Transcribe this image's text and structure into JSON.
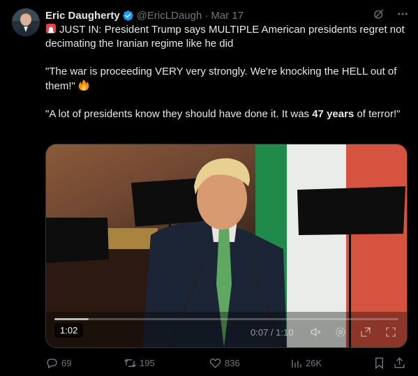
{
  "author": {
    "display_name": "Eric Daugherty",
    "handle": "@EricLDaugh",
    "separator": "·",
    "date": "Mar 17"
  },
  "header_icons": [
    "grok-icon",
    "more-icon"
  ],
  "tweet": {
    "line1_prefix": "JUST IN: President Trump says MULTIPLE American presidents regret not decimating the Iranian regime like he did",
    "line2": "\"The war is proceeding VERY very strongly. We're knocking the HELL out of them!\"",
    "line3_a": "\"A lot of presidents know they should have done it. It was ",
    "line3_bold": "47 years",
    "line3_b": " of terror!\""
  },
  "video": {
    "duration_badge": "1:02",
    "time_readout": "0:07 / 1:10",
    "progress": 0.1,
    "control_icons": [
      "mute-icon",
      "settings-icon",
      "expand-icon",
      "fullscreen-icon"
    ]
  },
  "metrics": {
    "replies": "69",
    "reposts": "195",
    "likes": "836",
    "views": "26K"
  },
  "colors": {
    "background": "#000000",
    "text": "#e7e9ea",
    "muted": "#71767b",
    "verified": "#1d9bf0"
  }
}
